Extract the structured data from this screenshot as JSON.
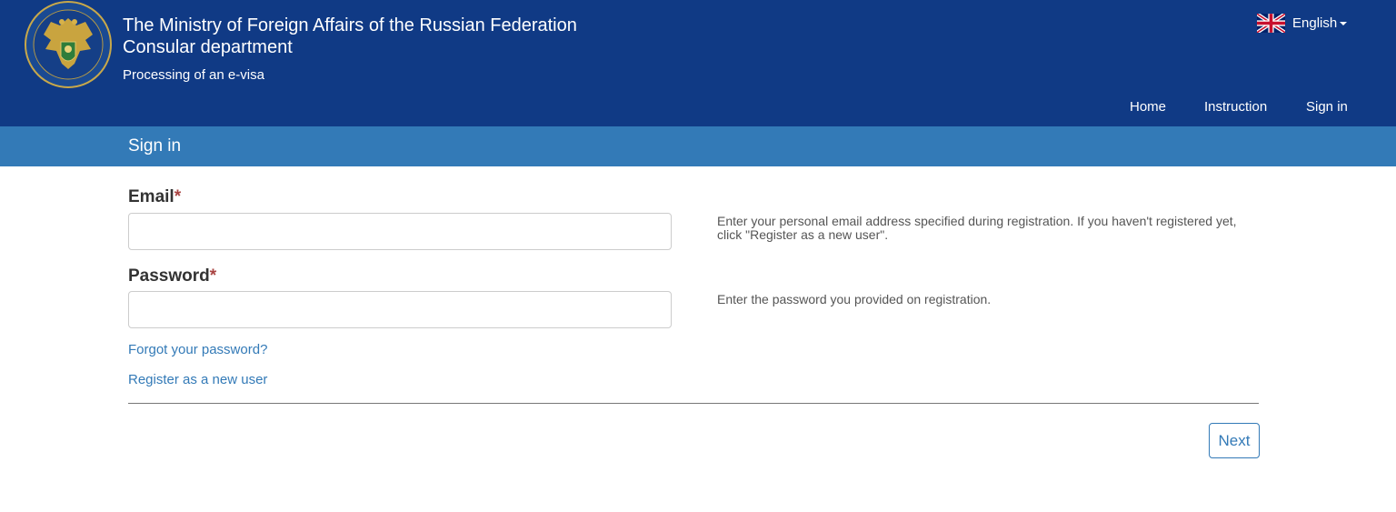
{
  "header": {
    "title_line1": "The Ministry of Foreign Affairs of the Russian Federation",
    "title_line2": "Consular department",
    "subtitle": "Processing of an e-visa",
    "language": {
      "label": "English",
      "flag_icon": "uk-flag-icon"
    },
    "nav": [
      {
        "label": "Home"
      },
      {
        "label": "Instruction"
      },
      {
        "label": "Sign in"
      }
    ],
    "colors": {
      "header_bg": "#103a85",
      "section_bg": "#337ab7"
    }
  },
  "section": {
    "title": "Sign in"
  },
  "form": {
    "email": {
      "label": "Email",
      "required_mark": "*",
      "value": "",
      "help": "Enter your personal email address specified during registration. If you haven't registered yet, click \"Register as a new user\"."
    },
    "password": {
      "label": "Password",
      "required_mark": "*",
      "value": "",
      "help": "Enter the password you provided on registration."
    },
    "forgot_link": "Forgot your password?",
    "register_link": "Register as a new user",
    "next_button": "Next"
  },
  "colors": {
    "link": "#337ab7",
    "required": "#a94442"
  }
}
